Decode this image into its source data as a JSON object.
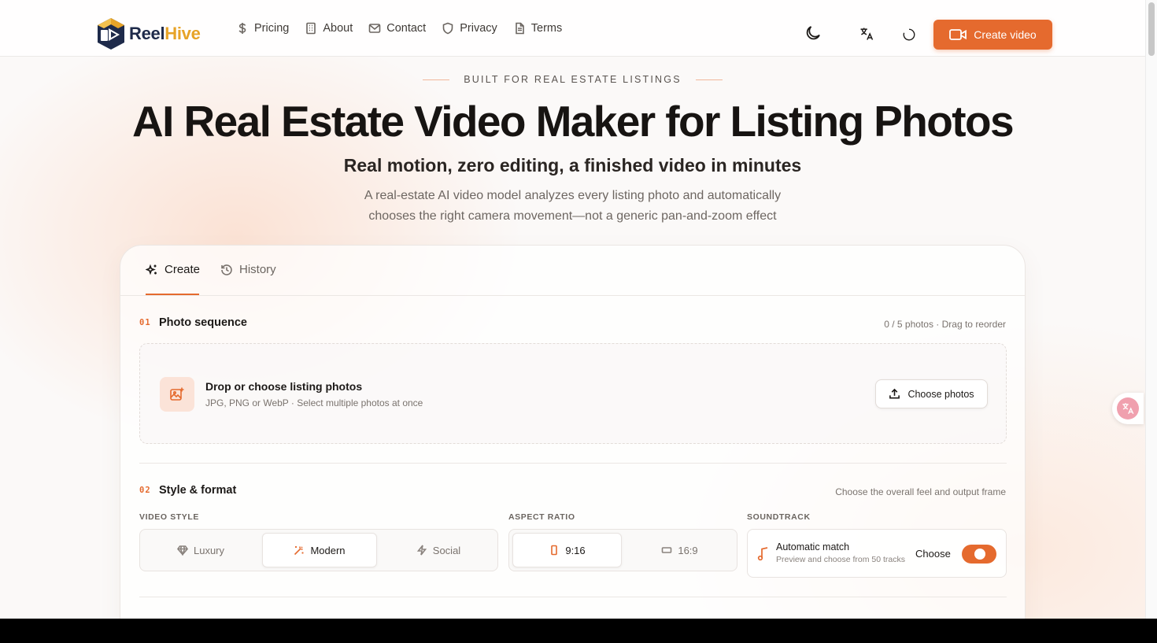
{
  "brand": {
    "name_part1": "Reel",
    "name_part2": "Hive",
    "colors": {
      "navy": "#1e2a4a",
      "gold": "#e7a327",
      "accent": "#e56a2e"
    }
  },
  "nav": {
    "items": [
      {
        "label": "Pricing",
        "icon": "dollar-icon"
      },
      {
        "label": "About",
        "icon": "building-icon"
      },
      {
        "label": "Contact",
        "icon": "mail-icon"
      },
      {
        "label": "Privacy",
        "icon": "shield-icon"
      },
      {
        "label": "Terms",
        "icon": "document-icon"
      }
    ]
  },
  "header": {
    "icons": [
      "moon-icon",
      "translate-icon",
      "loading-icon"
    ],
    "cta_label": "Create video"
  },
  "hero": {
    "eyebrow": "BUILT FOR REAL ESTATE LISTINGS",
    "title": "AI Real Estate Video Maker for Listing Photos",
    "subtitle": "Real motion, zero editing, a finished video in minutes",
    "description": "A real-estate AI video model analyzes every listing photo and automatically chooses the right camera movement—not a generic pan-and-zoom effect"
  },
  "tabs": [
    {
      "label": "Create",
      "icon": "sparkles-icon",
      "active": true
    },
    {
      "label": "History",
      "icon": "history-icon",
      "active": false
    }
  ],
  "photo_section": {
    "number": "01",
    "title": "Photo sequence",
    "meta": "0 / 5 photos · Drag to reorder",
    "dropzone_title": "Drop or choose listing photos",
    "dropzone_sub": "JPG, PNG or WebP · Select multiple photos at once",
    "choose_label": "Choose photos"
  },
  "style_section": {
    "number": "02",
    "title": "Style & format",
    "meta": "Choose the overall feel and output frame",
    "video_style_label": "VIDEO STYLE",
    "video_styles": [
      {
        "label": "Luxury",
        "icon": "gem-icon",
        "selected": false
      },
      {
        "label": "Modern",
        "icon": "wand-icon",
        "selected": true
      },
      {
        "label": "Social",
        "icon": "bolt-icon",
        "selected": false
      }
    ],
    "aspect_label": "ASPECT RATIO",
    "aspect_ratios": [
      {
        "label": "9:16",
        "icon": "portrait-icon",
        "selected": true
      },
      {
        "label": "16:9",
        "icon": "landscape-icon",
        "selected": false
      }
    ],
    "soundtrack_label": "SOUNDTRACK",
    "soundtrack_title": "Automatic match",
    "soundtrack_sub": "Preview and choose from 50 tracks",
    "soundtrack_choose": "Choose",
    "soundtrack_enabled": true
  }
}
